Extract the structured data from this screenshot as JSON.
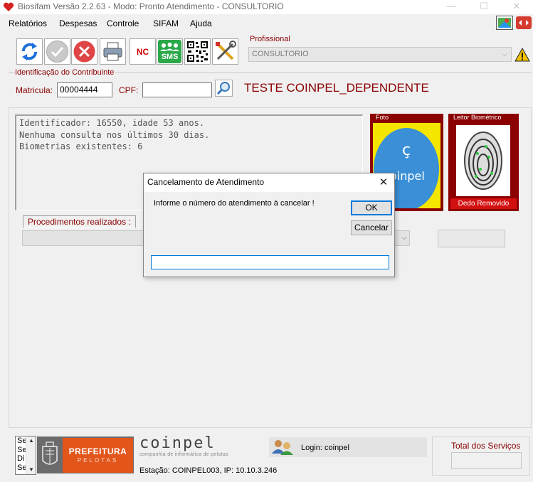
{
  "window": {
    "title": "Biosifam Versão 2.2.63 - Modo: Pronto Atendimento - CONSULTORIO",
    "controls": {
      "minimize": "—",
      "maximize": "☐",
      "close": "✕"
    }
  },
  "menu": {
    "items": [
      "Relatórios",
      "Despesas",
      "Controle",
      "SIFAM",
      "Ajuda"
    ]
  },
  "toolbar": {
    "icons": [
      "refresh-icon",
      "check-icon",
      "cancel-icon",
      "printer-icon",
      "nc-icon",
      "sms-icon",
      "qrcode-icon",
      "tools-icon"
    ],
    "nc_label": "NC",
    "sms_label": "SMS"
  },
  "profissional": {
    "label": "Profissional",
    "value": "CONSULTORIO"
  },
  "identificacao": {
    "label": "Identificação do Contribuinte",
    "matricula_label": "Matricula:",
    "matricula_value": "00004444",
    "cpf_label": "CPF:",
    "cpf_value": "",
    "patient_name": "TESTE COINPEL_DEPENDENTE"
  },
  "info": {
    "lines": [
      "Identificador: 16550, idade 53 anos.",
      "Nenhuma consulta nos últimos 30 dias.",
      "Biometrias existentes: 6"
    ]
  },
  "foto": {
    "label": "Foto",
    "logo_text": "oinpel"
  },
  "leitor": {
    "label": "Leitor Biométrico",
    "status": "Dedo Removido"
  },
  "procedimentos": {
    "label": "Procedimentos realizados :"
  },
  "dialog": {
    "title": "Cancelamento de Atendimento",
    "message": "Informe o número do atendimento à cancelar !",
    "ok_label": "OK",
    "cancel_label": "Cancelar",
    "input_value": ""
  },
  "footer": {
    "list_items": [
      "Se",
      "Se",
      "Di",
      "Se"
    ],
    "prefeitura": "PREFEITURA",
    "pelotas": "PELOTAS",
    "coinpel": "coinpel",
    "coinpel_sub": "companhia de informática de pelotas",
    "station": "Estação: COINPEL003, IP: 10.10.3.246",
    "login": "Login: coinpel",
    "total_label": "Total dos Serviços"
  },
  "colors": {
    "accent_red": "#8b0000",
    "dialog_focus": "#0078d7",
    "prefeitura_orange": "#e2561c"
  }
}
